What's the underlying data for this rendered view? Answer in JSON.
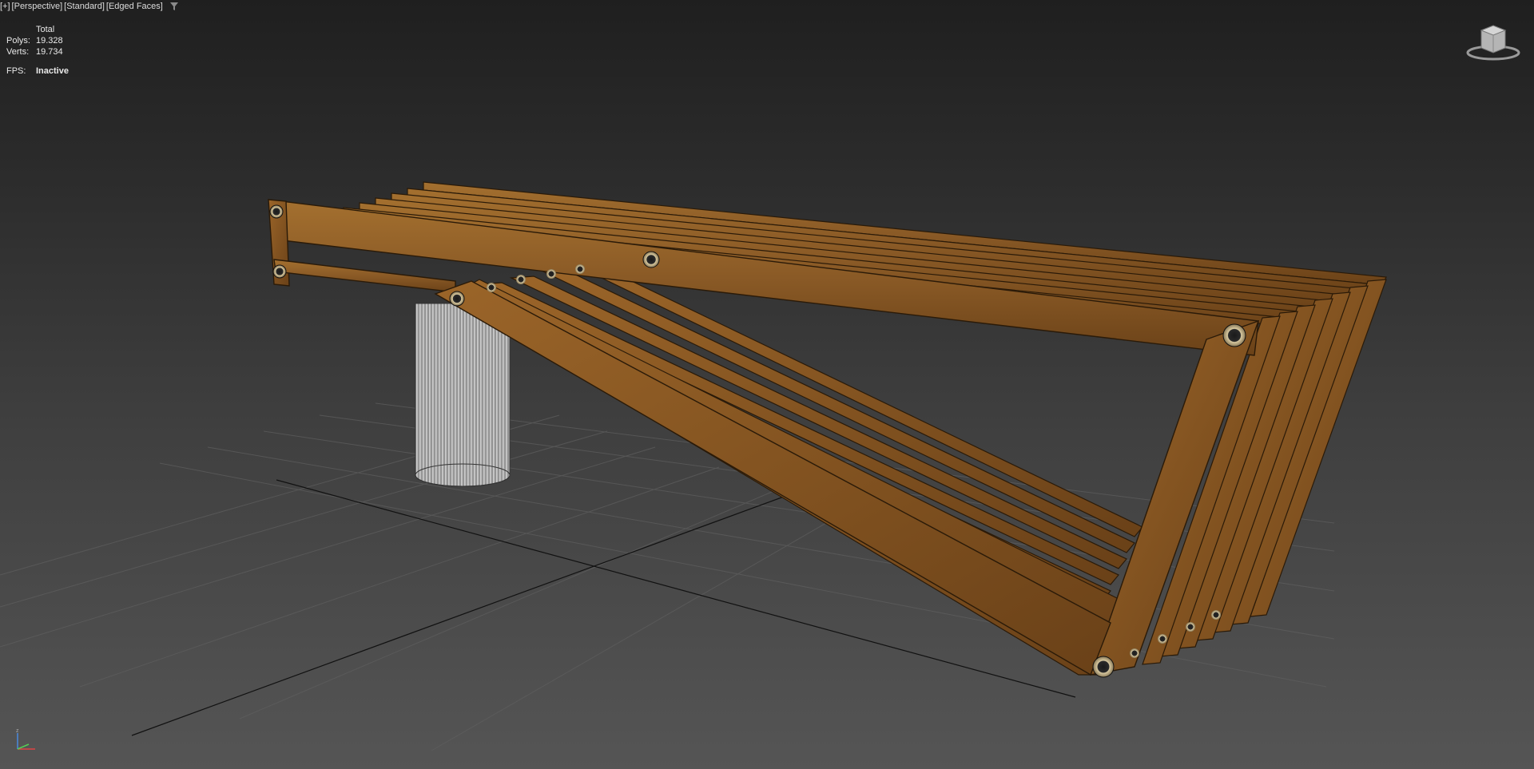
{
  "viewport": {
    "labels": [
      "[+]",
      "[Perspective]",
      "[Standard]",
      "[Edged Faces]"
    ]
  },
  "stats": {
    "header": "Total",
    "polys_label": "Polys:",
    "polys_value": "19.328",
    "verts_label": "Verts:",
    "verts_value": "19.734",
    "fps_label": "FPS:",
    "fps_value": "Inactive"
  },
  "icons": {
    "filter": "filter-icon",
    "viewcube": "viewcube-icon",
    "axis": "axis-tripod-icon"
  },
  "colors": {
    "wood": "#8a5a26",
    "wood_dark": "#5a3614",
    "cylinder": "#b9b9b9",
    "grid": "#5a5a5a"
  }
}
